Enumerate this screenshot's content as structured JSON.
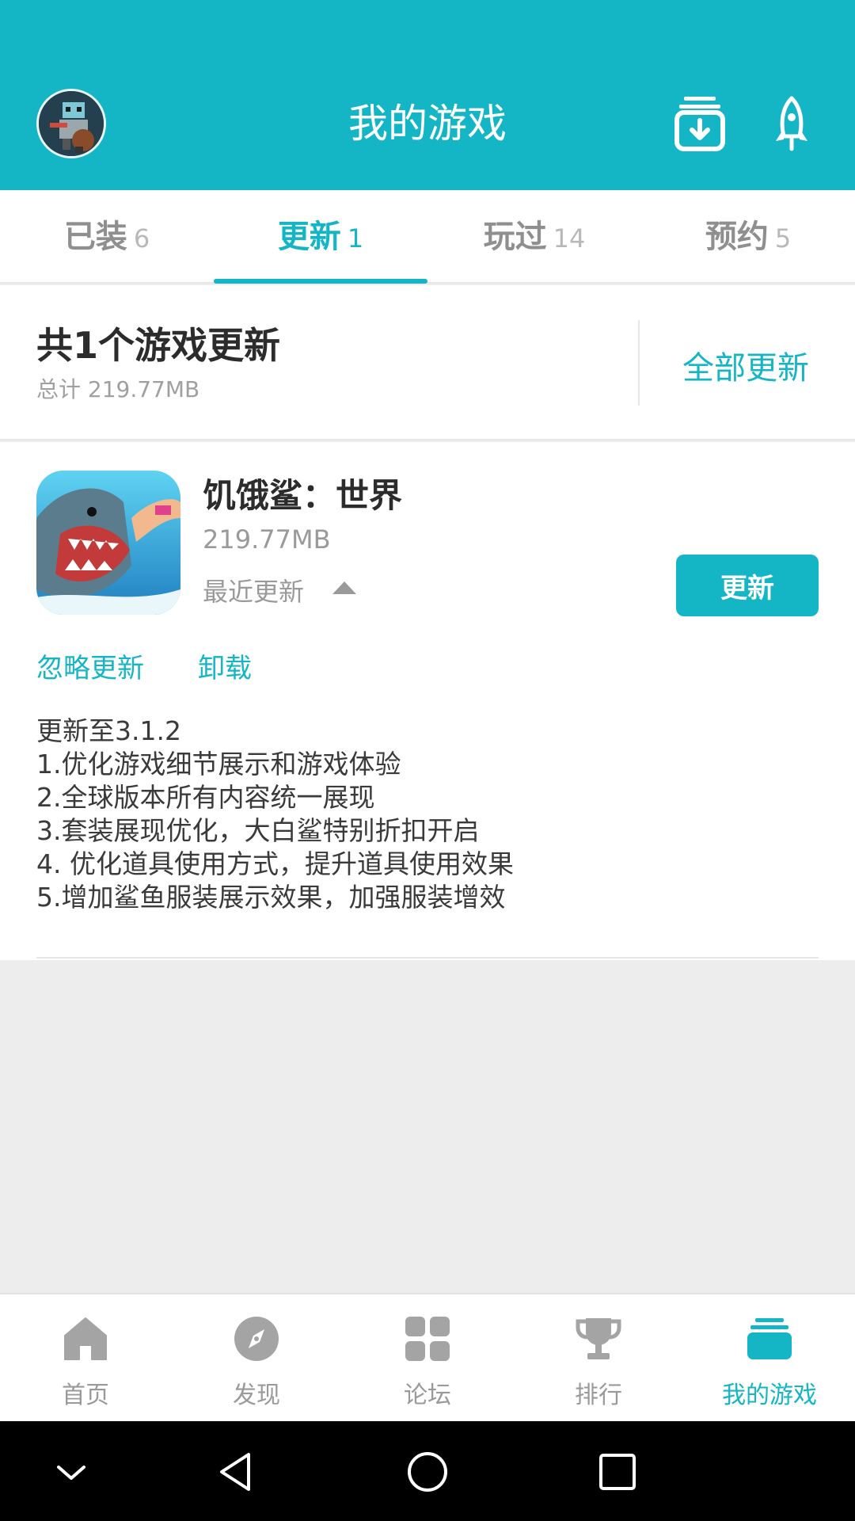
{
  "header": {
    "title": "我的游戏"
  },
  "tabs": [
    {
      "label": "已装",
      "count": "6"
    },
    {
      "label": "更新",
      "count": "1"
    },
    {
      "label": "玩过",
      "count": "14"
    },
    {
      "label": "预约",
      "count": "5"
    }
  ],
  "summary": {
    "title": "共1个游戏更新",
    "total": "总计  219.77MB",
    "update_all": "全部更新"
  },
  "game": {
    "name": "饥饿鲨：世界",
    "size": "219.77MB",
    "recent_label": "最近更新",
    "update_button": "更新",
    "ignore_link": "忽略更新",
    "uninstall_link": "卸载",
    "notes": [
      "更新至3.1.2",
      "1.优化游戏细节展示和游戏体验",
      "2.全球版本所有内容统一展现",
      "3.套装展现优化，大白鲨特别折扣开启",
      "4. 优化道具使用方式，提升道具使用效果",
      "5.增加鲨鱼服装展示效果，加强服装增效"
    ]
  },
  "nav": [
    {
      "label": "首页",
      "icon": "home-icon"
    },
    {
      "label": "发现",
      "icon": "compass-icon"
    },
    {
      "label": "论坛",
      "icon": "grid-icon"
    },
    {
      "label": "排行",
      "icon": "trophy-icon"
    },
    {
      "label": "我的游戏",
      "icon": "stack-icon"
    }
  ],
  "colors": {
    "accent": "#14b6c6",
    "inactive": "#9a9a9a",
    "background": "#ededed"
  }
}
